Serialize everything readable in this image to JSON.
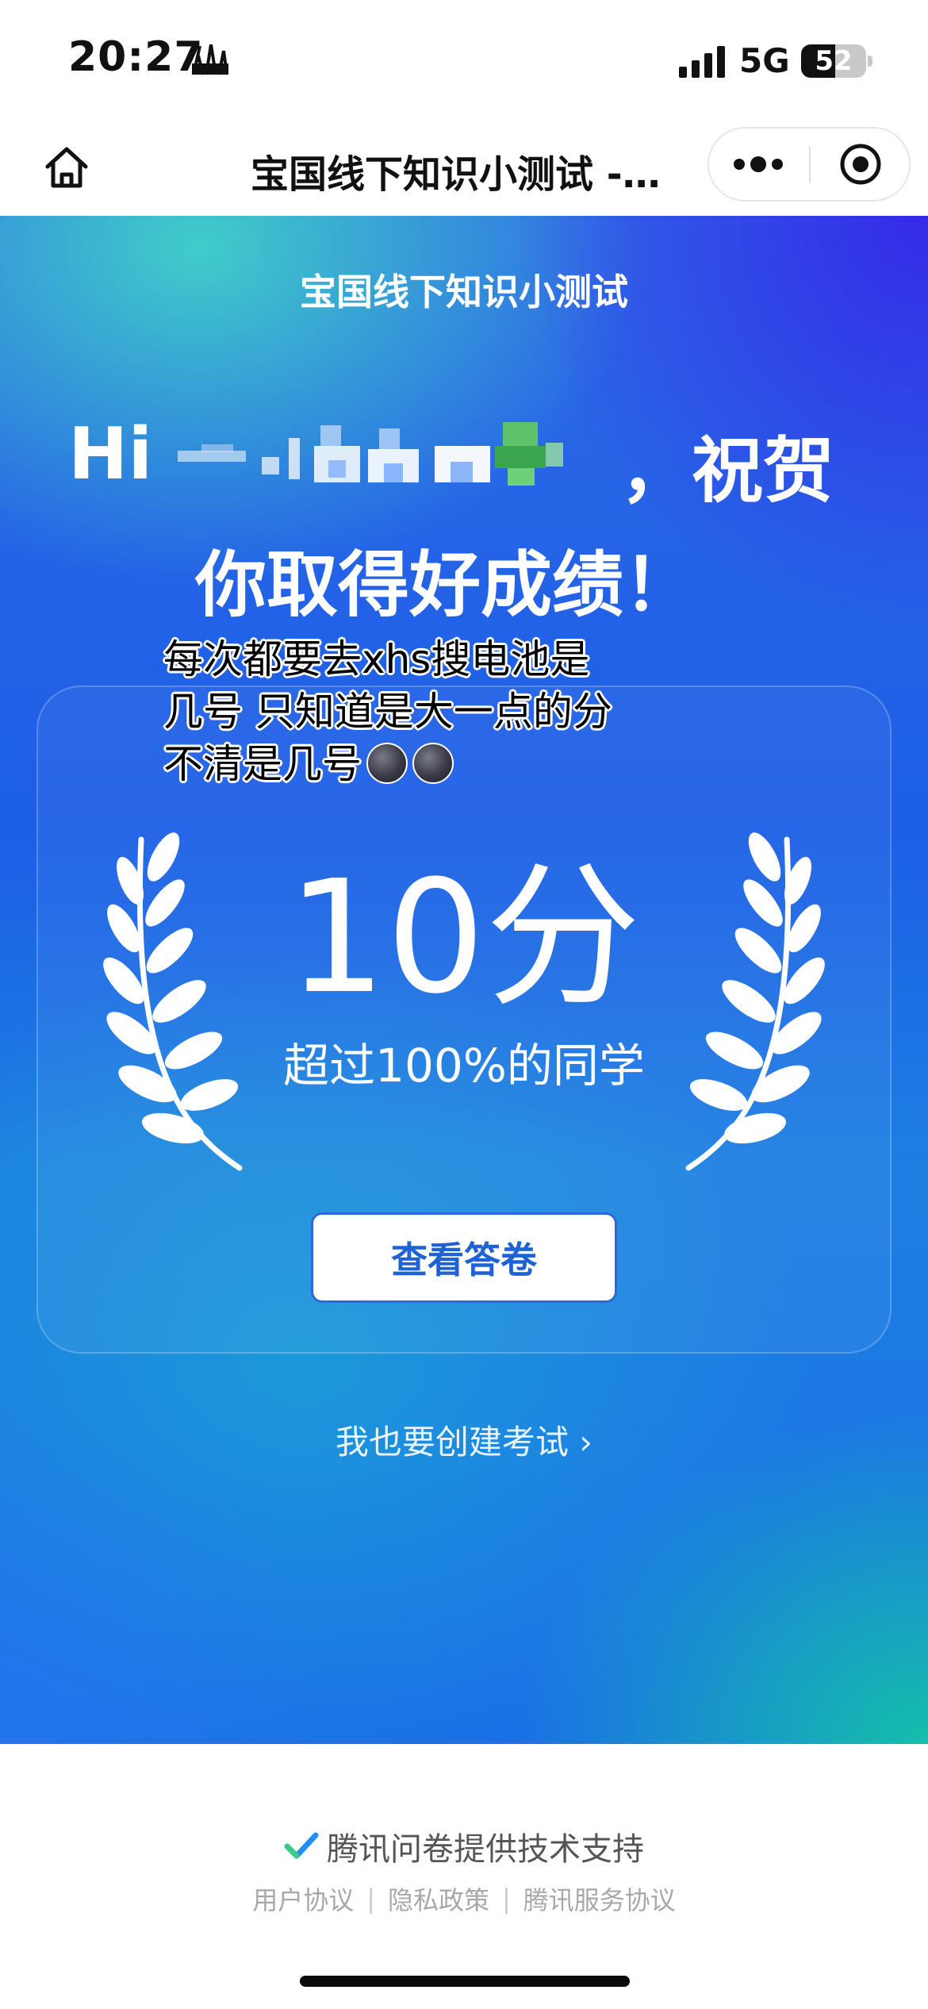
{
  "status_bar": {
    "time": "20:27",
    "network": "5G",
    "battery": "52",
    "battery_level": 0.52
  },
  "nav": {
    "title": "宝国线下知识小测试 -…",
    "home_icon": "home-icon",
    "more_icon": "more-dots-icon",
    "close_icon": "target-close-icon"
  },
  "hero": {
    "quiz_title": "宝国线下知识小测试",
    "greeting_hi": "Hi",
    "greeting_suffix": "，祝贺",
    "greeting_line2": "你取得好成绩！",
    "note_lines": [
      "每次都要去xhs搜电池是",
      "几号 只知道是大一点的分",
      "不清是几号"
    ],
    "score": "10分",
    "score_sub": "超过100%的同学",
    "view_answers": "查看答卷",
    "create_exam": "我也要创建考试 ›"
  },
  "footer": {
    "powered": "腾讯问卷提供技术支持",
    "links": [
      "用户协议",
      "隐私政策",
      "腾讯服务协议"
    ]
  },
  "colors": {
    "accent": "#1f62d6",
    "teal": "#43dec4",
    "violet": "#3426e8",
    "green": "#14cda0"
  }
}
